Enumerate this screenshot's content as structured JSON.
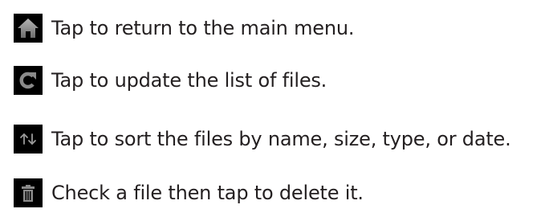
{
  "instructions": [
    {
      "icon": "home-icon",
      "text": "Tap to return to the main menu."
    },
    {
      "icon": "refresh-icon",
      "text": "Tap to update the list of files."
    },
    {
      "icon": "sort-icon",
      "text": "Tap to sort the files by name, size, type, or date."
    },
    {
      "icon": "trash-icon",
      "text": "Check a file then tap to delete it."
    }
  ],
  "colors": {
    "text": "#231f20",
    "icon_background": "#000000",
    "icon_glyph": "#8a8a8a"
  }
}
